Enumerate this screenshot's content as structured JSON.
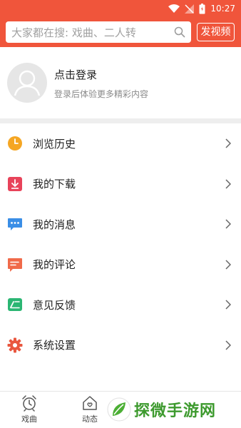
{
  "status_bar": {
    "time": "10:27"
  },
  "search": {
    "placeholder": "大家都在搜: 戏曲、二人转",
    "icon": "search-icon"
  },
  "header": {
    "post_video_label": "发视频"
  },
  "profile": {
    "title": "点击登录",
    "subtitle": "登录后体验更多精彩内容"
  },
  "menu": {
    "items": [
      {
        "label": "浏览历史",
        "icon": "clock-icon",
        "color": "#f5a623"
      },
      {
        "label": "我的下载",
        "icon": "download-icon",
        "color": "#e8435a"
      },
      {
        "label": "我的消息",
        "icon": "message-icon",
        "color": "#3a8ee6"
      },
      {
        "label": "我的评论",
        "icon": "comment-icon",
        "color": "#f06a4a"
      },
      {
        "label": "意见反馈",
        "icon": "feedback-icon",
        "color": "#2bb673"
      },
      {
        "label": "系统设置",
        "icon": "gear-icon",
        "color": "#e9573f"
      }
    ]
  },
  "bottom_nav": {
    "items": [
      {
        "label": "戏曲",
        "icon": "alarm-clock-icon"
      },
      {
        "label": "动态",
        "icon": "home-heart-icon"
      }
    ]
  },
  "watermark": {
    "text": "探微手游网"
  },
  "colors": {
    "brand": "#f0553b",
    "divider": "#eeeeee"
  }
}
